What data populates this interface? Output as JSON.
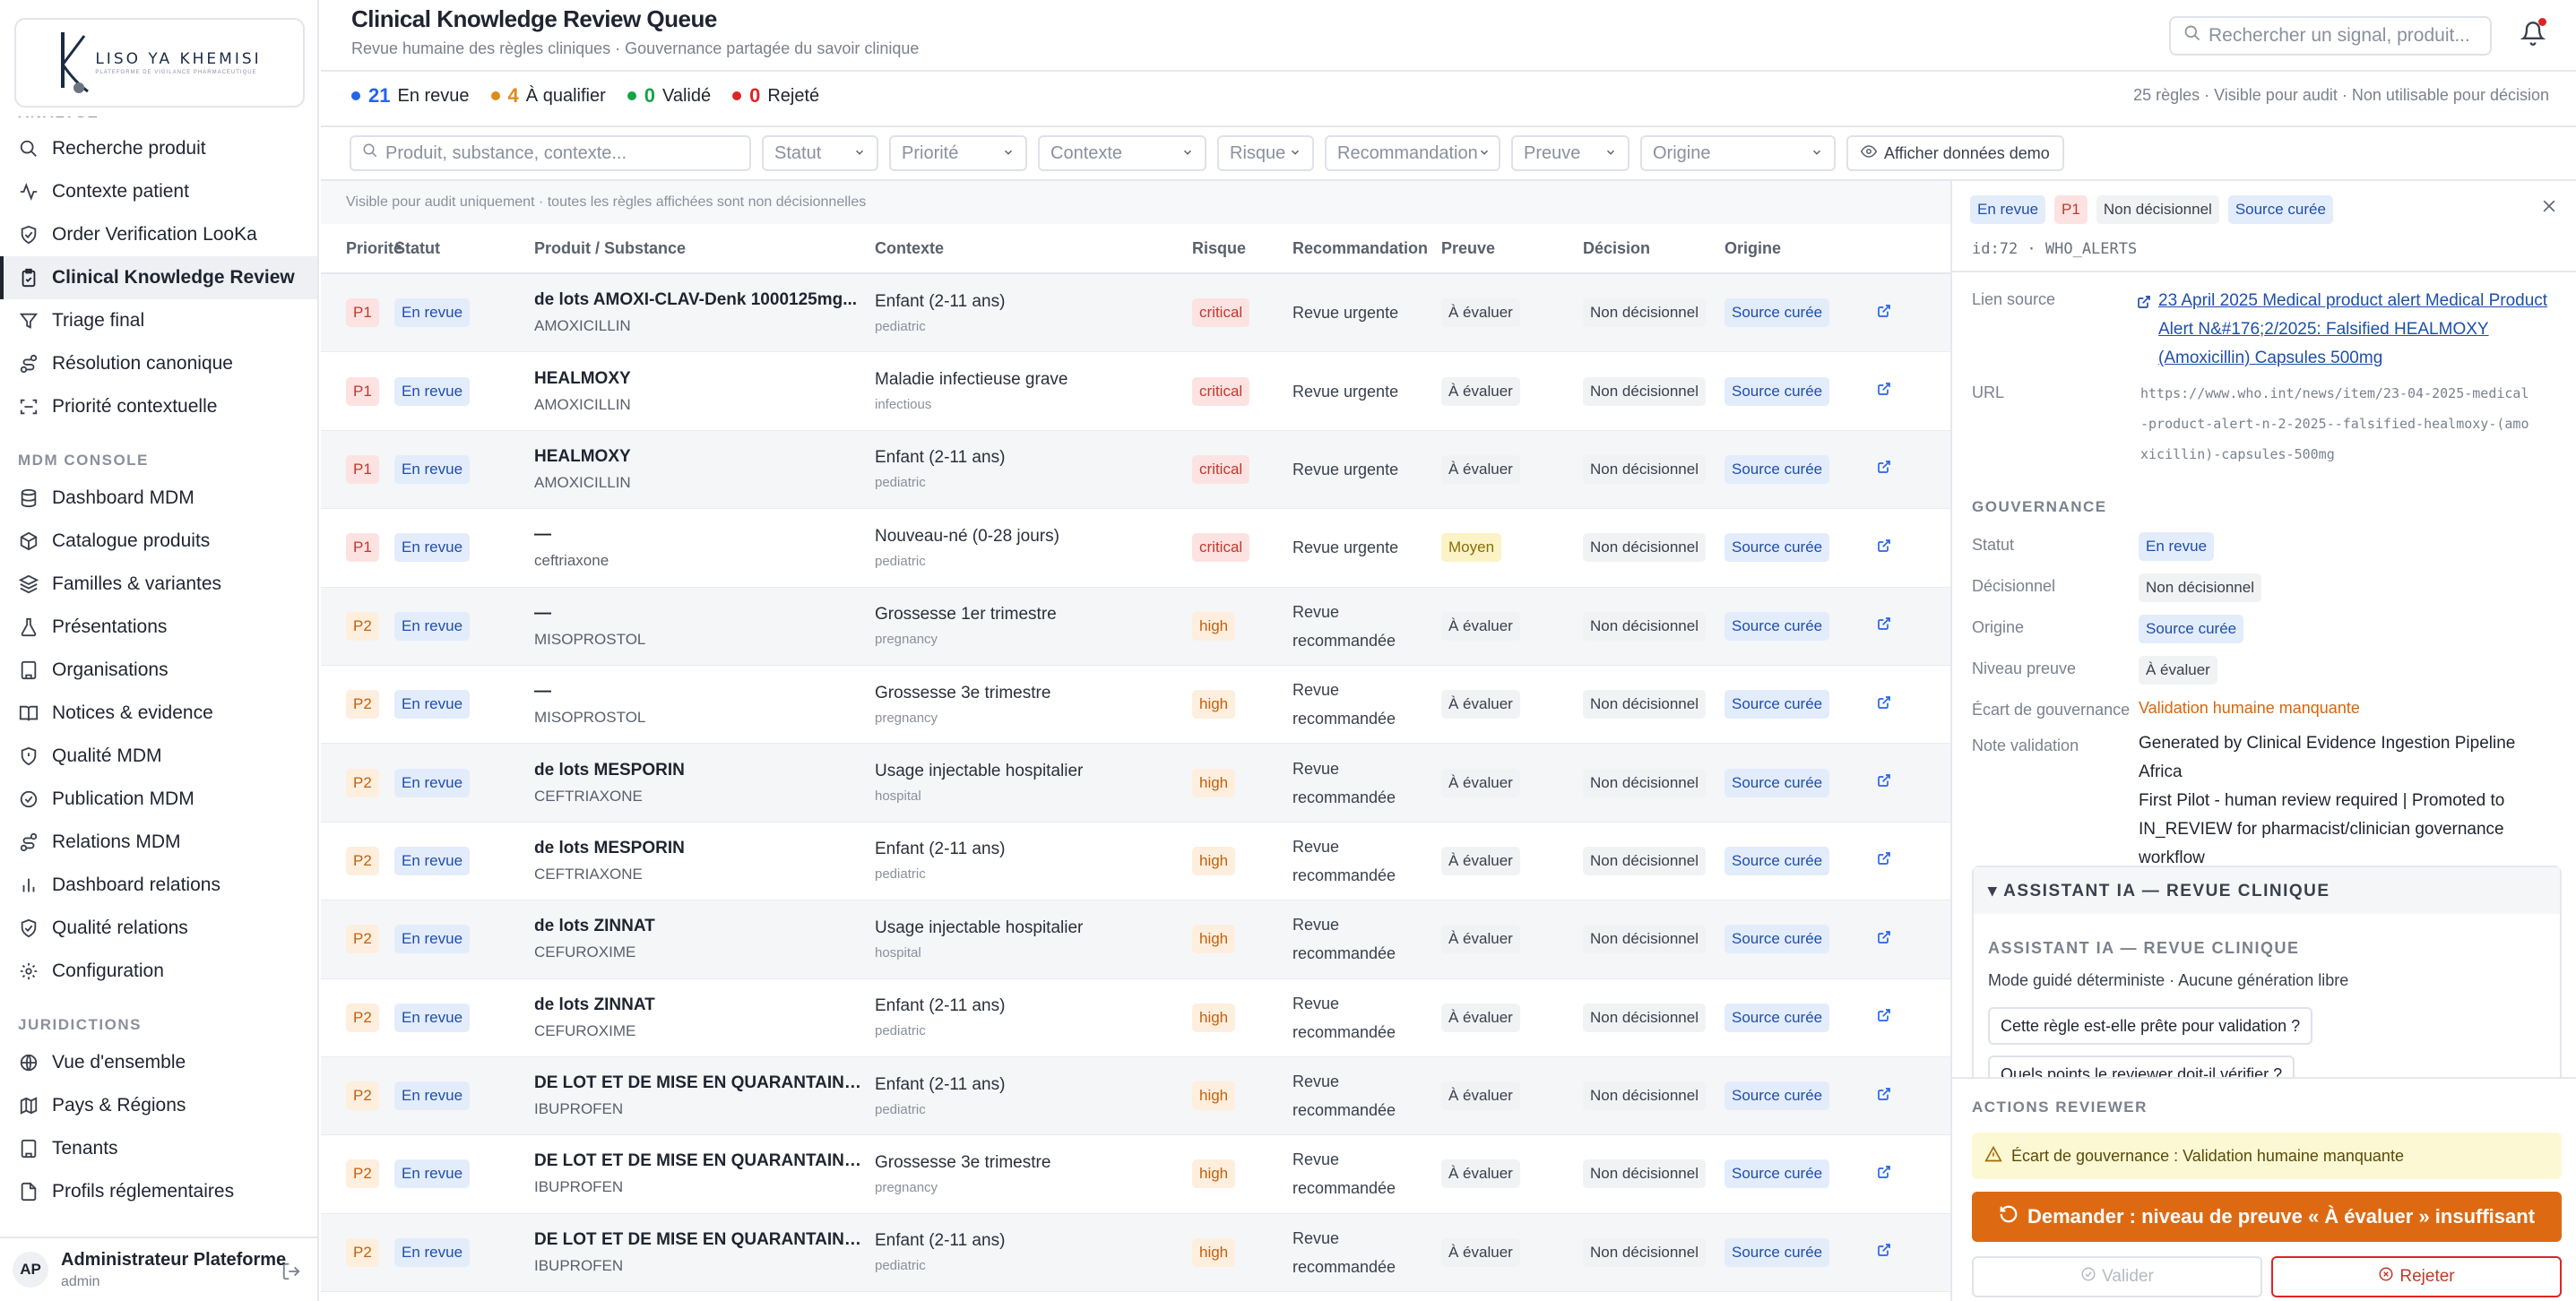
{
  "sidebar": {
    "logo_text": "LISO YA KHEMISI",
    "logo_sub": "PLATEFORME DE VIGILANCE PHARMACEUTIQUE",
    "sections": [
      {
        "title": "ANALYSE",
        "items": [
          {
            "label": "Recherche produit",
            "icon": "search-icon"
          },
          {
            "label": "Contexte patient",
            "icon": "activity-icon"
          },
          {
            "label": "Order Verification LooKa",
            "icon": "shield-check-icon"
          },
          {
            "label": "Clinical Knowledge Review",
            "icon": "clipboard-check-icon"
          },
          {
            "label": "Triage final",
            "icon": "filter-icon"
          },
          {
            "label": "Résolution canonique",
            "icon": "route-icon"
          },
          {
            "label": "Priorité contextuelle",
            "icon": "scan-icon"
          }
        ]
      },
      {
        "title": "MDM CONSOLE",
        "items": [
          {
            "label": "Dashboard MDM",
            "icon": "database-icon"
          },
          {
            "label": "Catalogue produits",
            "icon": "package-icon"
          },
          {
            "label": "Familles & variantes",
            "icon": "layers-icon"
          },
          {
            "label": "Présentations",
            "icon": "flask-icon"
          },
          {
            "label": "Organisations",
            "icon": "building-icon"
          },
          {
            "label": "Notices & evidence",
            "icon": "book-icon"
          },
          {
            "label": "Qualité MDM",
            "icon": "shield-alert-icon"
          },
          {
            "label": "Publication MDM",
            "icon": "check-circle-icon"
          },
          {
            "label": "Relations MDM",
            "icon": "route-icon"
          },
          {
            "label": "Dashboard relations",
            "icon": "bar-chart-icon"
          },
          {
            "label": "Qualité relations",
            "icon": "shield-check-icon"
          },
          {
            "label": "Configuration",
            "icon": "gear-icon"
          }
        ]
      },
      {
        "title": "JURIDICTIONS",
        "items": [
          {
            "label": "Vue d'ensemble",
            "icon": "globe-icon"
          },
          {
            "label": "Pays & Régions",
            "icon": "map-icon"
          },
          {
            "label": "Tenants",
            "icon": "building-icon"
          },
          {
            "label": "Profils réglementaires",
            "icon": "file-icon"
          }
        ]
      }
    ],
    "user": {
      "initials": "AP",
      "name": "Administrateur Plateforme",
      "role": "admin"
    }
  },
  "header": {
    "title": "Clinical Knowledge Review Queue",
    "subtitle": "Revue humaine des règles cliniques · Gouvernance partagée du savoir clinique",
    "search_placeholder": "Rechercher un signal, produit..."
  },
  "stats": [
    {
      "count": "21",
      "label": "En revue",
      "color": "#2563eb"
    },
    {
      "count": "4",
      "label": "À qualifier",
      "color": "#e08a1a"
    },
    {
      "count": "0",
      "label": "Validé",
      "color": "#16a34a"
    },
    {
      "count": "0",
      "label": "Rejeté",
      "color": "#dc2626"
    }
  ],
  "stats_info": "25 règles · Visible pour audit · Non utilisable pour décision",
  "filters": {
    "search_placeholder": "Produit, substance, contexte...",
    "selects": [
      "Statut",
      "Priorité",
      "Contexte",
      "Risque",
      "Recommandation",
      "Preuve",
      "Origine"
    ],
    "demo_button": "Afficher données demo"
  },
  "table": {
    "note": "Visible pour audit uniquement · toutes les règles affichées sont non décisionnelles",
    "columns": [
      "Priorité",
      "Statut",
      "Produit / Substance",
      "Contexte",
      "Risque",
      "Recommandation",
      "Preuve",
      "Décision",
      "Origine"
    ],
    "rows": [
      {
        "priority": "P1",
        "status": "En revue",
        "product": "de lots AMOXI-CLAV-Denk 1000125mg...",
        "substance": "AMOXICILLIN",
        "context": "Enfant (2-11 ans)",
        "context_sub": "pediatric",
        "risk": "critical",
        "reco": [
          "Revue urgente"
        ],
        "evidence": "À évaluer",
        "decision": "Non décisionnel",
        "origin": "Source curée"
      },
      {
        "priority": "P1",
        "status": "En revue",
        "product": "HEALMOXY",
        "substance": "AMOXICILLIN",
        "context": "Maladie infectieuse grave",
        "context_sub": "infectious",
        "risk": "critical",
        "reco": [
          "Revue urgente"
        ],
        "evidence": "À évaluer",
        "decision": "Non décisionnel",
        "origin": "Source curée"
      },
      {
        "priority": "P1",
        "status": "En revue",
        "product": "HEALMOXY",
        "substance": "AMOXICILLIN",
        "context": "Enfant (2-11 ans)",
        "context_sub": "pediatric",
        "risk": "critical",
        "reco": [
          "Revue urgente"
        ],
        "evidence": "À évaluer",
        "decision": "Non décisionnel",
        "origin": "Source curée"
      },
      {
        "priority": "P1",
        "status": "En revue",
        "product": "—",
        "substance": "ceftriaxone",
        "context": "Nouveau-né (0-28 jours)",
        "context_sub": "pediatric",
        "risk": "critical",
        "reco": [
          "Revue urgente"
        ],
        "evidence": "Moyen",
        "decision": "Non décisionnel",
        "origin": "Source curée"
      },
      {
        "priority": "P2",
        "status": "En revue",
        "product": "—",
        "substance": "MISOPROSTOL",
        "context": "Grossesse 1er trimestre",
        "context_sub": "pregnancy",
        "risk": "high",
        "reco": [
          "Revue",
          "recommandée"
        ],
        "evidence": "À évaluer",
        "decision": "Non décisionnel",
        "origin": "Source curée"
      },
      {
        "priority": "P2",
        "status": "En revue",
        "product": "—",
        "substance": "MISOPROSTOL",
        "context": "Grossesse 3e trimestre",
        "context_sub": "pregnancy",
        "risk": "high",
        "reco": [
          "Revue",
          "recommandée"
        ],
        "evidence": "À évaluer",
        "decision": "Non décisionnel",
        "origin": "Source curée"
      },
      {
        "priority": "P2",
        "status": "En revue",
        "product": "de lots MESPORIN",
        "substance": "CEFTRIAXONE",
        "context": "Usage injectable hospitalier",
        "context_sub": "hospital",
        "risk": "high",
        "reco": [
          "Revue",
          "recommandée"
        ],
        "evidence": "À évaluer",
        "decision": "Non décisionnel",
        "origin": "Source curée"
      },
      {
        "priority": "P2",
        "status": "En revue",
        "product": "de lots MESPORIN",
        "substance": "CEFTRIAXONE",
        "context": "Enfant (2-11 ans)",
        "context_sub": "pediatric",
        "risk": "high",
        "reco": [
          "Revue",
          "recommandée"
        ],
        "evidence": "À évaluer",
        "decision": "Non décisionnel",
        "origin": "Source curée"
      },
      {
        "priority": "P2",
        "status": "En revue",
        "product": "de lots ZINNAT",
        "substance": "CEFUROXIME",
        "context": "Usage injectable hospitalier",
        "context_sub": "hospital",
        "risk": "high",
        "reco": [
          "Revue",
          "recommandée"
        ],
        "evidence": "À évaluer",
        "decision": "Non décisionnel",
        "origin": "Source curée"
      },
      {
        "priority": "P2",
        "status": "En revue",
        "product": "de lots ZINNAT",
        "substance": "CEFUROXIME",
        "context": "Enfant (2-11 ans)",
        "context_sub": "pediatric",
        "risk": "high",
        "reco": [
          "Revue",
          "recommandée"
        ],
        "evidence": "À évaluer",
        "decision": "Non décisionnel",
        "origin": "Source curée"
      },
      {
        "priority": "P2",
        "status": "En revue",
        "product": "DE LOT ET DE MISE EN QUARANTAINE I...",
        "substance": "IBUPROFEN",
        "context": "Enfant (2-11 ans)",
        "context_sub": "pediatric",
        "risk": "high",
        "reco": [
          "Revue",
          "recommandée"
        ],
        "evidence": "À évaluer",
        "decision": "Non décisionnel",
        "origin": "Source curée"
      },
      {
        "priority": "P2",
        "status": "En revue",
        "product": "DE LOT ET DE MISE EN QUARANTAINE I...",
        "substance": "IBUPROFEN",
        "context": "Grossesse 3e trimestre",
        "context_sub": "pregnancy",
        "risk": "high",
        "reco": [
          "Revue",
          "recommandée"
        ],
        "evidence": "À évaluer",
        "decision": "Non décisionnel",
        "origin": "Source curée"
      },
      {
        "priority": "P2",
        "status": "En revue",
        "product": "DE LOT ET DE MISE EN QUARANTAINE I...",
        "substance": "IBUPROFEN",
        "context": "Enfant (2-11 ans)",
        "context_sub": "pediatric",
        "risk": "high",
        "reco": [
          "Revue",
          "recommandée"
        ],
        "evidence": "À évaluer",
        "decision": "Non décisionnel",
        "origin": "Source curée"
      }
    ]
  },
  "panel": {
    "badges": [
      "En revue",
      "P1",
      "Non décisionnel",
      "Source curée"
    ],
    "id": "id:72 · WHO_ALERTS",
    "source_label": "Lien source",
    "source_link": [
      "23 April 2025 Medical product alert Medical Product",
      "Alert N&#176;2/2025: Falsified HEALMOXY",
      "(Amoxicillin) Capsules 500mg"
    ],
    "url_label": "URL",
    "url_value": [
      "https://www.who.int/news/item/23-04-2025-medical",
      "-product-alert-n-2-2025--falsified-healmoxy-(amo",
      "xicillin)-capsules-500mg"
    ],
    "gov_title": "GOUVERNANCE",
    "gov": {
      "statut_label": "Statut",
      "statut": "En revue",
      "decision_label": "Décisionnel",
      "decision": "Non décisionnel",
      "origin_label": "Origine",
      "origin": "Source curée",
      "evidence_label": "Niveau preuve",
      "evidence": "À évaluer",
      "gap_label": "Écart de gouvernance",
      "gap": "Validation humaine manquante",
      "note_label": "Note validation",
      "note": [
        "Generated by Clinical Evidence Ingestion Pipeline Africa",
        "First Pilot - human review required | Promoted to",
        "IN_REVIEW for pharmacist/clinician governance",
        "workflow"
      ]
    },
    "ai": {
      "header": "▾ ASSISTANT IA — REVUE CLINIQUE",
      "title": "ASSISTANT IA — REVUE CLINIQUE",
      "subtitle": "Mode guidé déterministe · Aucune génération libre",
      "questions": [
        "Cette règle est-elle prête pour validation ?",
        "Quels points le reviewer doit-il vérifier ?"
      ]
    },
    "actions": {
      "title": "ACTIONS REVIEWER",
      "warning": "Écart de gouvernance : Validation humaine manquante",
      "request": "Demander : niveau de preuve « À évaluer » insuffisant",
      "validate": "Valider",
      "reject": "Rejeter"
    }
  },
  "colors": {
    "accent_orange": "#dd6a13",
    "reject_red": "#e02424",
    "link_blue": "#1f4fa8"
  }
}
